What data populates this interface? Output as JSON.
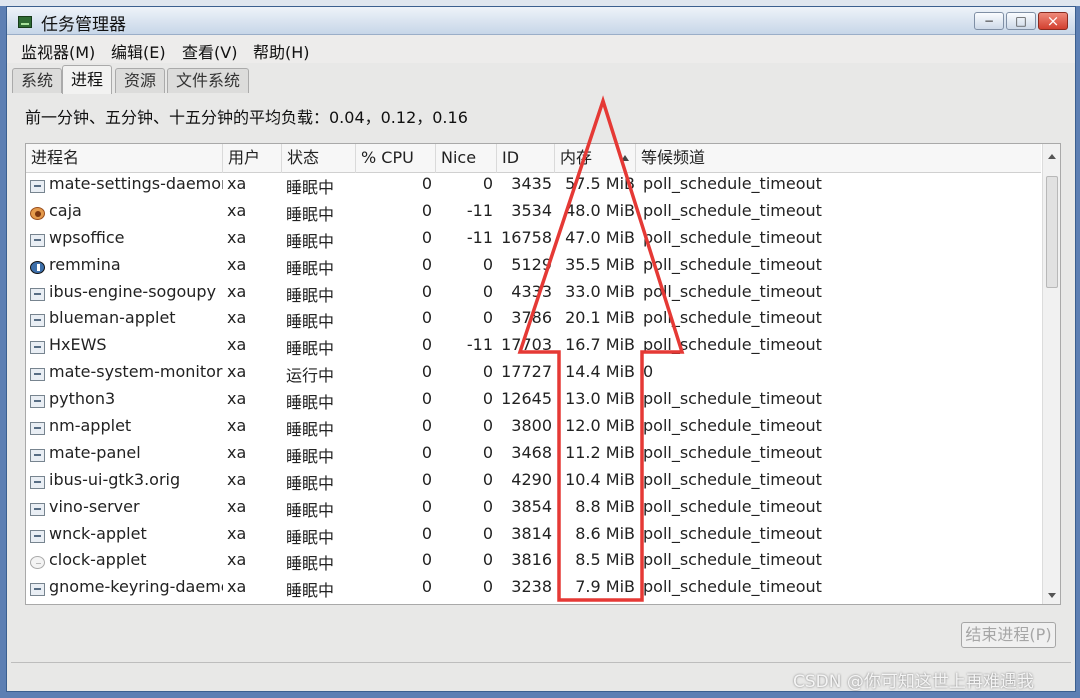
{
  "window": {
    "title": "任务管理器",
    "minimize": "−",
    "maximize": "□",
    "close": "×"
  },
  "menu": [
    "监视器(M)",
    "编辑(E)",
    "查看(V)",
    "帮助(H)"
  ],
  "tabs": [
    "系统",
    "进程",
    "资源",
    "文件系统"
  ],
  "load_text": "前一分钟、五分钟、十五分钟的平均负载：0.04，0.12，0.16",
  "table": {
    "headers": [
      "进程名",
      "用户",
      "状态",
      "% CPU",
      "Nice",
      "ID",
      "内存",
      "等候频道"
    ],
    "rows": [
      {
        "icon": "app-icon",
        "name": "mate-settings-daemon",
        "user": "xa",
        "state": "睡眠中",
        "cpu": "0",
        "nice": "0",
        "id": "3435",
        "mem": "57.5 MiB",
        "wait": "poll_schedule_timeout"
      },
      {
        "icon": "caja-icon",
        "name": "caja",
        "user": "xa",
        "state": "睡眠中",
        "cpu": "0",
        "nice": "-11",
        "id": "3534",
        "mem": "48.0 MiB",
        "wait": "poll_schedule_timeout"
      },
      {
        "icon": "app-icon",
        "name": "wpsoffice",
        "user": "xa",
        "state": "睡眠中",
        "cpu": "0",
        "nice": "-11",
        "id": "16758",
        "mem": "47.0 MiB",
        "wait": "poll_schedule_timeout"
      },
      {
        "icon": "remmina-icon",
        "name": "remmina",
        "user": "xa",
        "state": "睡眠中",
        "cpu": "0",
        "nice": "0",
        "id": "5129",
        "mem": "35.5 MiB",
        "wait": "poll_schedule_timeout"
      },
      {
        "icon": "app-icon",
        "name": "ibus-engine-sogoupy",
        "user": "xa",
        "state": "睡眠中",
        "cpu": "0",
        "nice": "0",
        "id": "4333",
        "mem": "33.0 MiB",
        "wait": "poll_schedule_timeout"
      },
      {
        "icon": "app-icon",
        "name": "blueman-applet",
        "user": "xa",
        "state": "睡眠中",
        "cpu": "0",
        "nice": "0",
        "id": "3786",
        "mem": "20.1 MiB",
        "wait": "poll_schedule_timeout"
      },
      {
        "icon": "app-icon",
        "name": "HxEWS",
        "user": "xa",
        "state": "睡眠中",
        "cpu": "0",
        "nice": "-11",
        "id": "17703",
        "mem": "16.7 MiB",
        "wait": "poll_schedule_timeout"
      },
      {
        "icon": "app-icon",
        "name": "mate-system-monitor",
        "user": "xa",
        "state": "运行中",
        "cpu": "0",
        "nice": "0",
        "id": "17727",
        "mem": "14.4 MiB",
        "wait": "0"
      },
      {
        "icon": "app-icon",
        "name": "python3",
        "user": "xa",
        "state": "睡眠中",
        "cpu": "0",
        "nice": "0",
        "id": "12645",
        "mem": "13.0 MiB",
        "wait": "poll_schedule_timeout"
      },
      {
        "icon": "app-icon",
        "name": "nm-applet",
        "user": "xa",
        "state": "睡眠中",
        "cpu": "0",
        "nice": "0",
        "id": "3800",
        "mem": "12.0 MiB",
        "wait": "poll_schedule_timeout"
      },
      {
        "icon": "app-icon",
        "name": "mate-panel",
        "user": "xa",
        "state": "睡眠中",
        "cpu": "0",
        "nice": "0",
        "id": "3468",
        "mem": "11.2 MiB",
        "wait": "poll_schedule_timeout"
      },
      {
        "icon": "app-icon",
        "name": "ibus-ui-gtk3.orig",
        "user": "xa",
        "state": "睡眠中",
        "cpu": "0",
        "nice": "0",
        "id": "4290",
        "mem": "10.4 MiB",
        "wait": "poll_schedule_timeout"
      },
      {
        "icon": "app-icon",
        "name": "vino-server",
        "user": "xa",
        "state": "睡眠中",
        "cpu": "0",
        "nice": "0",
        "id": "3854",
        "mem": "8.8 MiB",
        "wait": "poll_schedule_timeout"
      },
      {
        "icon": "app-icon",
        "name": "wnck-applet",
        "user": "xa",
        "state": "睡眠中",
        "cpu": "0",
        "nice": "0",
        "id": "3814",
        "mem": "8.6 MiB",
        "wait": "poll_schedule_timeout"
      },
      {
        "icon": "clock-icon",
        "name": "clock-applet",
        "user": "xa",
        "state": "睡眠中",
        "cpu": "0",
        "nice": "0",
        "id": "3816",
        "mem": "8.5 MiB",
        "wait": "poll_schedule_timeout"
      },
      {
        "icon": "app-icon",
        "name": "gnome-keyring-daemon",
        "user": "xa",
        "state": "睡眠中",
        "cpu": "0",
        "nice": "0",
        "id": "3238",
        "mem": "7.9 MiB",
        "wait": "poll_schedule_timeout"
      }
    ]
  },
  "end_button": "结束进程(P)",
  "watermark": "CSDN @你可知这世上再难遇我",
  "colors": {
    "annotation_red": "#e53935",
    "titlebar_blue": "#c7d6e8"
  }
}
